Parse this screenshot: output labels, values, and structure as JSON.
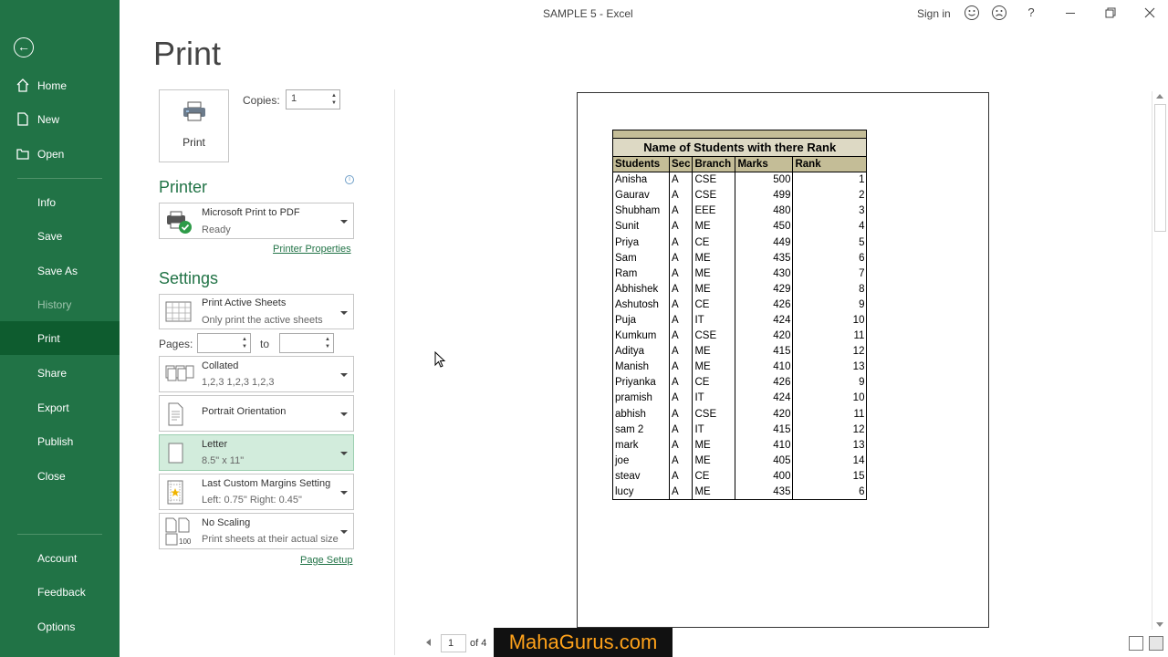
{
  "window": {
    "title": "SAMPLE 5  -  Excel",
    "sign_in": "Sign in",
    "help": "?"
  },
  "nav": {
    "items": [
      {
        "label": "Home"
      },
      {
        "label": "New"
      },
      {
        "label": "Open"
      },
      {
        "label": "Info"
      },
      {
        "label": "Save"
      },
      {
        "label": "Save As"
      },
      {
        "label": "History"
      },
      {
        "label": "Print"
      },
      {
        "label": "Share"
      },
      {
        "label": "Export"
      },
      {
        "label": "Publish"
      },
      {
        "label": "Close"
      },
      {
        "label": "Account"
      },
      {
        "label": "Feedback"
      },
      {
        "label": "Options"
      }
    ]
  },
  "print": {
    "heading": "Print",
    "button_label": "Print",
    "copies_label": "Copies:",
    "copies_value": "1"
  },
  "printer": {
    "section_title": "Printer",
    "name": "Microsoft Print to PDF",
    "status": "Ready",
    "properties_link": "Printer Properties"
  },
  "settings": {
    "section_title": "Settings",
    "sheets_main": "Print Active Sheets",
    "sheets_sub": "Only print the active sheets",
    "pages_label": "Pages:",
    "to_label": "to",
    "collated_main": "Collated",
    "collated_sub": "1,2,3    1,2,3    1,2,3",
    "orientation": "Portrait Orientation",
    "paper_main": "Letter",
    "paper_sub": "8.5\" x 11\"",
    "margins_main": "Last Custom Margins Setting",
    "margins_sub": "Left:  0.75\"    Right:  0.45\"",
    "scaling_main": "No Scaling",
    "scaling_sub": "Print sheets at their actual size",
    "scaling_icon_text": "100",
    "page_setup_link": "Page Setup"
  },
  "preview": {
    "caption": "Name of Students with there Rank",
    "headers": [
      "Students",
      "Sec",
      "Branch",
      "Marks",
      "Rank"
    ],
    "rows": [
      [
        "Anisha",
        "A",
        "CSE",
        "500",
        "1"
      ],
      [
        "Gaurav",
        "A",
        "CSE",
        "499",
        "2"
      ],
      [
        "Shubham",
        "A",
        "EEE",
        "480",
        "3"
      ],
      [
        "Sunit",
        "A",
        "ME",
        "450",
        "4"
      ],
      [
        "Priya",
        "A",
        "CE",
        "449",
        "5"
      ],
      [
        "Sam",
        "A",
        "ME",
        "435",
        "6"
      ],
      [
        "Ram",
        "A",
        "ME",
        "430",
        "7"
      ],
      [
        "Abhishek",
        "A",
        "ME",
        "429",
        "8"
      ],
      [
        "Ashutosh",
        "A",
        "CE",
        "426",
        "9"
      ],
      [
        "Puja",
        "A",
        "IT",
        "424",
        "10"
      ],
      [
        "Kumkum",
        "A",
        "CSE",
        "420",
        "11"
      ],
      [
        "Aditya",
        "A",
        "ME",
        "415",
        "12"
      ],
      [
        "Manish",
        "A",
        "ME",
        "410",
        "13"
      ],
      [
        "Priyanka",
        "A",
        "CE",
        "426",
        "9"
      ],
      [
        "pramish",
        "A",
        "IT",
        "424",
        "10"
      ],
      [
        "abhish",
        "A",
        "CSE",
        "420",
        "11"
      ],
      [
        "sam 2",
        "A",
        "IT",
        "415",
        "12"
      ],
      [
        "mark",
        "A",
        "ME",
        "410",
        "13"
      ],
      [
        "joe",
        "A",
        "ME",
        "405",
        "14"
      ],
      [
        "steav",
        "A",
        "CE",
        "400",
        "15"
      ],
      [
        "lucy",
        "A",
        "ME",
        "435",
        "6"
      ]
    ]
  },
  "pager": {
    "current": "1",
    "of_text": "of 4"
  },
  "watermark": "MahaGurus.com",
  "colors": {
    "accent": "#217346",
    "active_nav": "#0e5c2f",
    "highlight": "#d2ecdc"
  }
}
